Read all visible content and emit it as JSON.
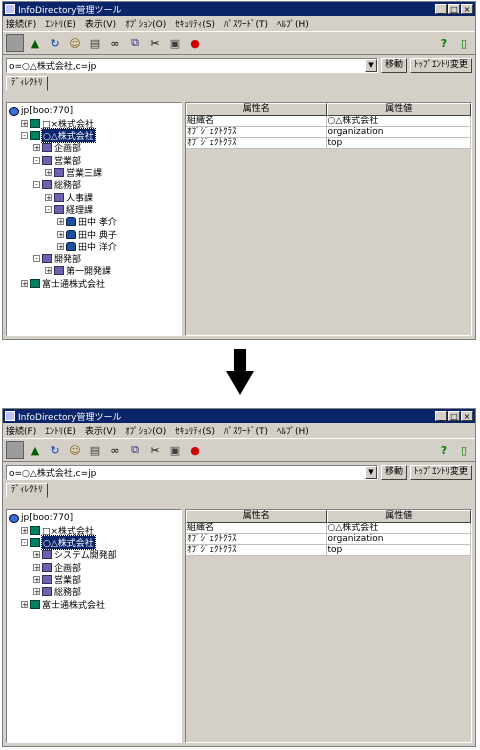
{
  "window": {
    "title": "InfoDirectory管理ツール",
    "controls": [
      "_",
      "□",
      "×"
    ]
  },
  "menu": [
    "接続(F)",
    "ｴﾝﾄﾘ(E)",
    "表示(V)",
    "ｵﾌﾟｼｮﾝ(O)",
    "ｾｷｭﾘﾃｨ(S)",
    "ﾊﾟｽﾜｰﾄﾞ(T)",
    "ﾍﾙﾌﾟ(H)"
  ],
  "toolbar": {
    "icons": [
      "stop-icon",
      "up-level-icon",
      "refresh-icon",
      "search-user-icon",
      "delete-icon",
      "find-icon",
      "copy-icon",
      "cut-icon",
      "paste-icon",
      "cancel-icon"
    ],
    "help_icon": "help-icon",
    "exit_icon": "exit-icon"
  },
  "address": {
    "value": "o=○△株式会社,c=jp",
    "move_label": "移動",
    "top_entry_label": "ﾄｯﾌﾟｴﾝﾄﾘ変更"
  },
  "tab": {
    "label": "ﾃﾞｨﾚｸﾄﾘ"
  },
  "grid": {
    "headers": [
      "属性名",
      "属性値"
    ],
    "rows": [
      [
        "組織名",
        "○△株式会社"
      ],
      [
        "ｵﾌﾞｼﾞｪｸﾄｸﾗｽ",
        "organization"
      ],
      [
        "ｵﾌﾞｼﾞｪｸﾄｸﾗｽ",
        "top"
      ]
    ]
  },
  "before": {
    "tree": [
      {
        "label": "jp[boo:770]",
        "level": 0,
        "kind": "root",
        "expander": ""
      },
      {
        "label": "□×株式会社",
        "level": 1,
        "kind": "org",
        "expander": "+"
      },
      {
        "label": "○△株式会社",
        "level": 1,
        "kind": "org",
        "expander": "-",
        "selected": true
      },
      {
        "label": "企画部",
        "level": 2,
        "kind": "ou",
        "expander": "+"
      },
      {
        "label": "営業部",
        "level": 2,
        "kind": "ou",
        "expander": "-"
      },
      {
        "label": "営業三課",
        "level": 3,
        "kind": "ou",
        "expander": "+"
      },
      {
        "label": "総務部",
        "level": 2,
        "kind": "ou",
        "expander": "-"
      },
      {
        "label": "人事課",
        "level": 3,
        "kind": "ou",
        "expander": "+"
      },
      {
        "label": "経理課",
        "level": 3,
        "kind": "ou",
        "expander": "-"
      },
      {
        "label": "田中 孝介",
        "level": 4,
        "kind": "person",
        "expander": "+"
      },
      {
        "label": "田中 典子",
        "level": 4,
        "kind": "person",
        "expander": "+"
      },
      {
        "label": "田中 洋介",
        "level": 4,
        "kind": "person",
        "expander": "+"
      },
      {
        "label": "開発部",
        "level": 2,
        "kind": "ou",
        "expander": "-"
      },
      {
        "label": "第一開発課",
        "level": 3,
        "kind": "ou",
        "expander": "+"
      },
      {
        "label": "富士通株式会社",
        "level": 1,
        "kind": "org",
        "expander": "+"
      }
    ]
  },
  "after": {
    "tree": [
      {
        "label": "jp[boo:770]",
        "level": 0,
        "kind": "root",
        "expander": ""
      },
      {
        "label": "□×株式会社",
        "level": 1,
        "kind": "org",
        "expander": "+"
      },
      {
        "label": "○△株式会社",
        "level": 1,
        "kind": "org",
        "expander": "-",
        "selected": true
      },
      {
        "label": "システム開発部",
        "level": 2,
        "kind": "ou",
        "expander": "+"
      },
      {
        "label": "企画部",
        "level": 2,
        "kind": "ou",
        "expander": "+"
      },
      {
        "label": "営業部",
        "level": 2,
        "kind": "ou",
        "expander": "+"
      },
      {
        "label": "総務部",
        "level": 2,
        "kind": "ou",
        "expander": "+"
      },
      {
        "label": "富士通株式会社",
        "level": 1,
        "kind": "org",
        "expander": "+"
      }
    ]
  }
}
